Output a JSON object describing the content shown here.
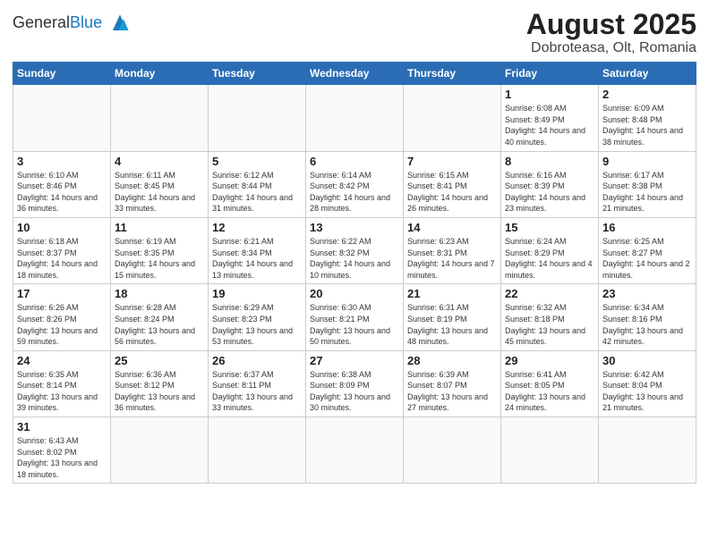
{
  "header": {
    "logo_general": "General",
    "logo_blue": "Blue",
    "title": "August 2025",
    "subtitle": "Dobroteasa, Olt, Romania"
  },
  "weekdays": [
    "Sunday",
    "Monday",
    "Tuesday",
    "Wednesday",
    "Thursday",
    "Friday",
    "Saturday"
  ],
  "rows": [
    [
      {
        "day": "",
        "info": ""
      },
      {
        "day": "",
        "info": ""
      },
      {
        "day": "",
        "info": ""
      },
      {
        "day": "",
        "info": ""
      },
      {
        "day": "",
        "info": ""
      },
      {
        "day": "1",
        "info": "Sunrise: 6:08 AM\nSunset: 8:49 PM\nDaylight: 14 hours and 40 minutes."
      },
      {
        "day": "2",
        "info": "Sunrise: 6:09 AM\nSunset: 8:48 PM\nDaylight: 14 hours and 38 minutes."
      }
    ],
    [
      {
        "day": "3",
        "info": "Sunrise: 6:10 AM\nSunset: 8:46 PM\nDaylight: 14 hours and 36 minutes."
      },
      {
        "day": "4",
        "info": "Sunrise: 6:11 AM\nSunset: 8:45 PM\nDaylight: 14 hours and 33 minutes."
      },
      {
        "day": "5",
        "info": "Sunrise: 6:12 AM\nSunset: 8:44 PM\nDaylight: 14 hours and 31 minutes."
      },
      {
        "day": "6",
        "info": "Sunrise: 6:14 AM\nSunset: 8:42 PM\nDaylight: 14 hours and 28 minutes."
      },
      {
        "day": "7",
        "info": "Sunrise: 6:15 AM\nSunset: 8:41 PM\nDaylight: 14 hours and 26 minutes."
      },
      {
        "day": "8",
        "info": "Sunrise: 6:16 AM\nSunset: 8:39 PM\nDaylight: 14 hours and 23 minutes."
      },
      {
        "day": "9",
        "info": "Sunrise: 6:17 AM\nSunset: 8:38 PM\nDaylight: 14 hours and 21 minutes."
      }
    ],
    [
      {
        "day": "10",
        "info": "Sunrise: 6:18 AM\nSunset: 8:37 PM\nDaylight: 14 hours and 18 minutes."
      },
      {
        "day": "11",
        "info": "Sunrise: 6:19 AM\nSunset: 8:35 PM\nDaylight: 14 hours and 15 minutes."
      },
      {
        "day": "12",
        "info": "Sunrise: 6:21 AM\nSunset: 8:34 PM\nDaylight: 14 hours and 13 minutes."
      },
      {
        "day": "13",
        "info": "Sunrise: 6:22 AM\nSunset: 8:32 PM\nDaylight: 14 hours and 10 minutes."
      },
      {
        "day": "14",
        "info": "Sunrise: 6:23 AM\nSunset: 8:31 PM\nDaylight: 14 hours and 7 minutes."
      },
      {
        "day": "15",
        "info": "Sunrise: 6:24 AM\nSunset: 8:29 PM\nDaylight: 14 hours and 4 minutes."
      },
      {
        "day": "16",
        "info": "Sunrise: 6:25 AM\nSunset: 8:27 PM\nDaylight: 14 hours and 2 minutes."
      }
    ],
    [
      {
        "day": "17",
        "info": "Sunrise: 6:26 AM\nSunset: 8:26 PM\nDaylight: 13 hours and 59 minutes."
      },
      {
        "day": "18",
        "info": "Sunrise: 6:28 AM\nSunset: 8:24 PM\nDaylight: 13 hours and 56 minutes."
      },
      {
        "day": "19",
        "info": "Sunrise: 6:29 AM\nSunset: 8:23 PM\nDaylight: 13 hours and 53 minutes."
      },
      {
        "day": "20",
        "info": "Sunrise: 6:30 AM\nSunset: 8:21 PM\nDaylight: 13 hours and 50 minutes."
      },
      {
        "day": "21",
        "info": "Sunrise: 6:31 AM\nSunset: 8:19 PM\nDaylight: 13 hours and 48 minutes."
      },
      {
        "day": "22",
        "info": "Sunrise: 6:32 AM\nSunset: 8:18 PM\nDaylight: 13 hours and 45 minutes."
      },
      {
        "day": "23",
        "info": "Sunrise: 6:34 AM\nSunset: 8:16 PM\nDaylight: 13 hours and 42 minutes."
      }
    ],
    [
      {
        "day": "24",
        "info": "Sunrise: 6:35 AM\nSunset: 8:14 PM\nDaylight: 13 hours and 39 minutes."
      },
      {
        "day": "25",
        "info": "Sunrise: 6:36 AM\nSunset: 8:12 PM\nDaylight: 13 hours and 36 minutes."
      },
      {
        "day": "26",
        "info": "Sunrise: 6:37 AM\nSunset: 8:11 PM\nDaylight: 13 hours and 33 minutes."
      },
      {
        "day": "27",
        "info": "Sunrise: 6:38 AM\nSunset: 8:09 PM\nDaylight: 13 hours and 30 minutes."
      },
      {
        "day": "28",
        "info": "Sunrise: 6:39 AM\nSunset: 8:07 PM\nDaylight: 13 hours and 27 minutes."
      },
      {
        "day": "29",
        "info": "Sunrise: 6:41 AM\nSunset: 8:05 PM\nDaylight: 13 hours and 24 minutes."
      },
      {
        "day": "30",
        "info": "Sunrise: 6:42 AM\nSunset: 8:04 PM\nDaylight: 13 hours and 21 minutes."
      }
    ],
    [
      {
        "day": "31",
        "info": "Sunrise: 6:43 AM\nSunset: 8:02 PM\nDaylight: 13 hours and 18 minutes."
      },
      {
        "day": "",
        "info": ""
      },
      {
        "day": "",
        "info": ""
      },
      {
        "day": "",
        "info": ""
      },
      {
        "day": "",
        "info": ""
      },
      {
        "day": "",
        "info": ""
      },
      {
        "day": "",
        "info": ""
      }
    ]
  ]
}
